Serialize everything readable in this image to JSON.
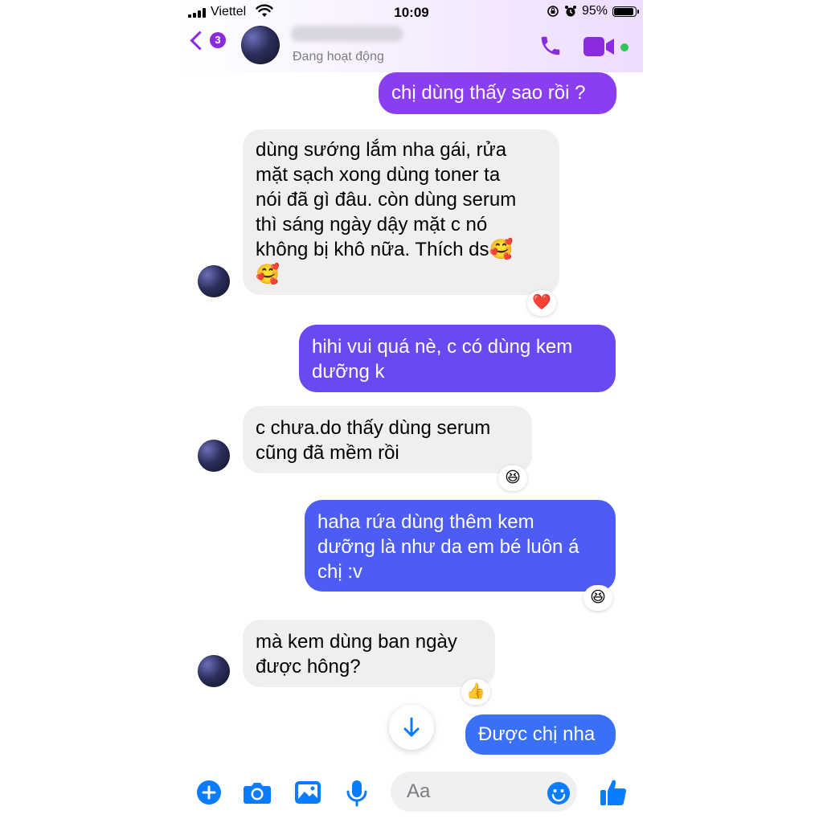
{
  "status_bar": {
    "carrier": "Viettel",
    "time": "10:09",
    "battery": "95%"
  },
  "header": {
    "back_count": "3",
    "contact_status": "Đang hoạt động",
    "icons": [
      "back-chevron-icon",
      "phone-icon",
      "video-camera-icon",
      "online-dot-icon"
    ]
  },
  "messages": [
    {
      "side": "out",
      "text": "chị dùng thấy sao rồi ?"
    },
    {
      "side": "in",
      "lines": [
        "dùng sướng lắm nha gái, rửa",
        "mặt sạch xong dùng toner ta",
        "nói đã gì đâu. còn dùng serum",
        "thì sáng ngày dậy mặt c nó",
        "không bị khô nữa. Thích ds🥰",
        "🥰"
      ],
      "reaction": "❤️"
    },
    {
      "side": "out",
      "lines": [
        "hihi vui quá nè, c có dùng kem",
        "dưỡng k"
      ]
    },
    {
      "side": "in",
      "lines": [
        "c chưa.do thấy dùng serum",
        "cũng đã mềm rồi"
      ],
      "reaction": "😆"
    },
    {
      "side": "out",
      "lines": [
        "haha rứa dùng thêm kem",
        "dưỡng là như da em bé luôn á",
        "chị :v"
      ],
      "reaction": "😆"
    },
    {
      "side": "in",
      "lines": [
        "mà kem dùng ban ngày",
        "được hông?"
      ],
      "reaction": "👍"
    },
    {
      "side": "out",
      "text": "Được chị nha"
    }
  ],
  "composer": {
    "placeholder": "Aa",
    "icons": [
      "plus-icon",
      "camera-icon",
      "gallery-icon",
      "microphone-icon",
      "emoji-icon",
      "thumbs-up-icon"
    ]
  },
  "colors": {
    "accent_purple": "#8a2be2",
    "bubble_out_1": "#8b3ef0",
    "bubble_out_2": "#6a4af0",
    "bubble_out_3": "#4c5cf4",
    "bubble_out_4": "#3a70f5",
    "bubble_in": "#efefef",
    "icon_blue": "#0a7cff",
    "online_green": "#31c653"
  }
}
